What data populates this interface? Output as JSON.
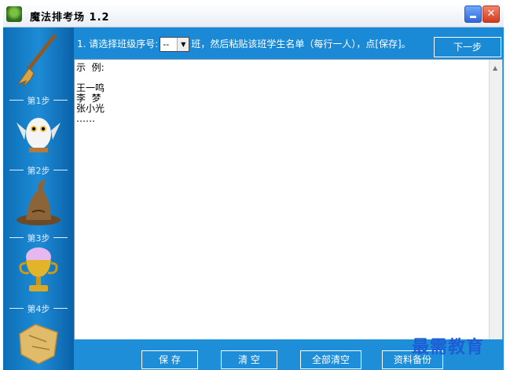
{
  "window": {
    "title": "魔法排考场 1.2"
  },
  "sidebar": {
    "steps": [
      {
        "label": "第1步",
        "icon": "broom-icon"
      },
      {
        "label": "第2步",
        "icon": "owl-icon"
      },
      {
        "label": "第3步",
        "icon": "sorting-hat-icon"
      },
      {
        "label": "第4步",
        "icon": "trophy-icon"
      },
      {
        "icon": "map-icon"
      }
    ]
  },
  "toolbar": {
    "instruction_prefix": "1. 请选择班级序号:",
    "class_select_value": "--",
    "instruction_suffix": "班，然后粘贴该班学生名单（每行一人），点[保存]。",
    "next_label": "下一步"
  },
  "editor": {
    "content": "示  例:\n\n王一鸣\n李  梦\n张小光\n……"
  },
  "bottom": {
    "save_label": "保  存",
    "clear_label": "清  空",
    "clear_all_label": "全部清空",
    "backup_label": "资料备份"
  },
  "watermark": "最需教育"
}
